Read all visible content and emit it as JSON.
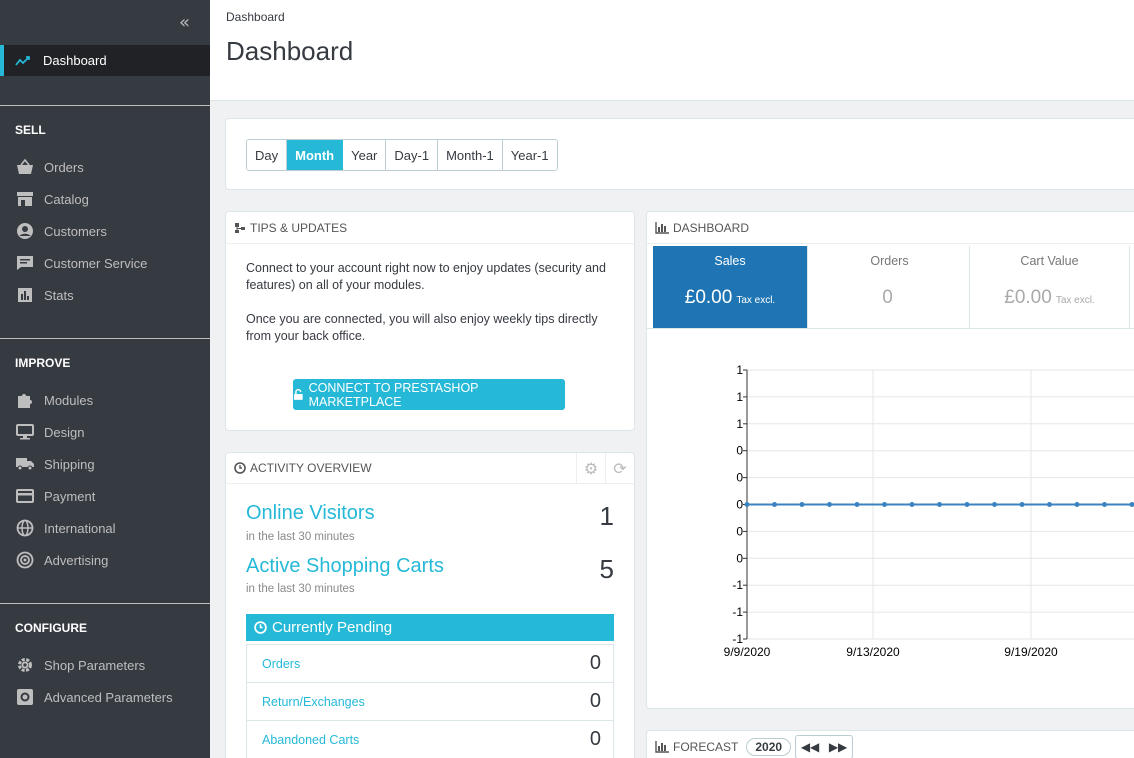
{
  "sidebar": {
    "collapse_label": "«",
    "active_item": "Dashboard",
    "sections": [
      {
        "title": "SELL",
        "items": [
          "Orders",
          "Catalog",
          "Customers",
          "Customer Service",
          "Stats"
        ]
      },
      {
        "title": "IMPROVE",
        "items": [
          "Modules",
          "Design",
          "Shipping",
          "Payment",
          "International",
          "Advertising"
        ]
      },
      {
        "title": "CONFIGURE",
        "items": [
          "Shop Parameters",
          "Advanced Parameters"
        ]
      }
    ]
  },
  "header": {
    "breadcrumb": "Dashboard",
    "title": "Dashboard"
  },
  "period_buttons": [
    "Day",
    "Month",
    "Year",
    "Day-1",
    "Month-1",
    "Year-1"
  ],
  "period_active": "Month",
  "tips": {
    "title": "TIPS & UPDATES",
    "paragraph1": "Connect to your account right now to enjoy updates (security and features) on all of your modules.",
    "paragraph2": "Once you are connected, you will also enjoy weekly tips directly from your back office.",
    "button": "CONNECT TO PRESTASHOP MARKETPLACE"
  },
  "activity": {
    "title": "ACTIVITY OVERVIEW",
    "online_visitors": {
      "label": "Online Visitors",
      "sub": "in the last 30 minutes",
      "value": "1"
    },
    "active_carts": {
      "label": "Active Shopping Carts",
      "sub": "in the last 30 minutes",
      "value": "5"
    },
    "pending_title": "Currently Pending",
    "pending": [
      {
        "label": "Orders",
        "value": "0"
      },
      {
        "label": "Return/Exchanges",
        "value": "0"
      },
      {
        "label": "Abandoned Carts",
        "value": "0"
      }
    ]
  },
  "dashboard": {
    "title": "DASHBOARD",
    "kpis": [
      {
        "label": "Sales",
        "value": "£0.00",
        "suffix": "Tax excl."
      },
      {
        "label": "Orders",
        "value": "0",
        "suffix": ""
      },
      {
        "label": "Cart Value",
        "value": "£0.00",
        "suffix": "Tax excl."
      }
    ]
  },
  "chart_data": {
    "type": "line",
    "y_tick_labels": [
      "1",
      "1",
      "1",
      "0",
      "0",
      "0",
      "0",
      "0",
      "-1",
      "-1",
      "-1"
    ],
    "x_tick_labels": [
      "9/9/2020",
      "9/13/2020",
      "9/19/2020"
    ],
    "series": [
      {
        "values": [
          0,
          0,
          0,
          0,
          0,
          0,
          0,
          0,
          0,
          0,
          0,
          0,
          0,
          0,
          0
        ]
      }
    ],
    "line_color": "#3b83c0"
  },
  "forecast": {
    "title": "FORECAST",
    "year": "2020",
    "prev": "◀◀",
    "next": "▶▶"
  },
  "colors": {
    "accent": "#25b9d7",
    "sidebar_bg": "#363a41",
    "kpi_active": "#1f75b3"
  }
}
